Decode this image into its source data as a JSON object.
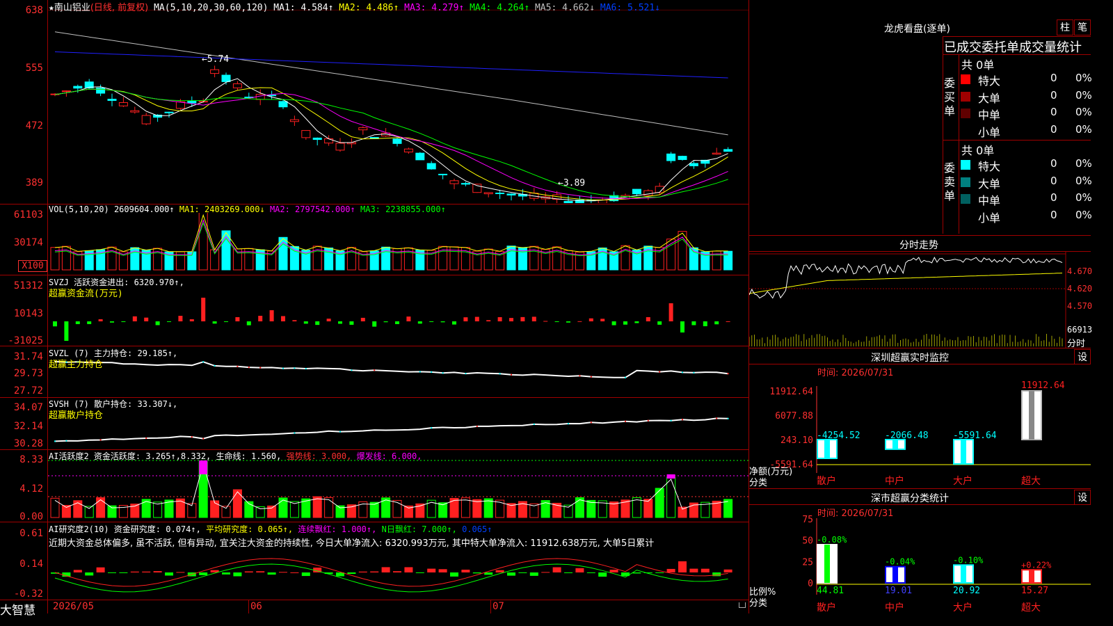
{
  "colors": {
    "up": "#ff2020",
    "down": "#00ffff",
    "grid": "#a00000",
    "axis": "#ff3030",
    "green": "#00ff00",
    "yellow": "#ffff00",
    "magenta": "#ff00ff",
    "blue": "#0000ff",
    "white": "#ffffff"
  },
  "main": {
    "star": "★",
    "stock_name": "南山铝业",
    "mode": "(日线, 前复权)",
    "ma_params": "MA(5,10,20,30,60,120)",
    "ma1": "MA1: 4.584↑",
    "ma2": "MA2: 4.486↑",
    "ma3": "MA3: 4.279↑",
    "ma4": "MA4: 4.264↑",
    "ma5": "MA5: 4.662↓",
    "ma6": "MA6: 5.521↓",
    "axis": [
      "638",
      "555",
      "472",
      "389"
    ],
    "high_marker": "←5.74",
    "low_marker": "←3.89"
  },
  "vol": {
    "title": "VOL(5,10,20)",
    "value": "2609604.000↑",
    "ma1": "MA1: 2403269.000↓",
    "ma2": "MA2: 2797542.000↑",
    "ma3": "MA3: 2238855.000↑",
    "axis": [
      "61103",
      "30174"
    ],
    "unit": "X100"
  },
  "svzj": {
    "title": "SVZJ 活跃资金进出: 6320.970↑,",
    "sub": "超赢资金流(万元)",
    "axis": [
      "51312",
      "10143",
      "-31025"
    ]
  },
  "svzl": {
    "title": "SVZL (7) 主力持仓: 29.185↑,",
    "sub": "超赢主力持仓",
    "axis": [
      "31.74",
      "29.73",
      "27.72"
    ]
  },
  "svsh": {
    "title": "SVSH (7) 散户持仓: 33.307↓,",
    "sub": "超赢散户持仓",
    "axis": [
      "34.07",
      "32.14",
      "30.28"
    ]
  },
  "ai1": {
    "title": "AI活跃度2 资金活跃度: 3.265↑,",
    "v2": "8.332,",
    "life": "生命线: 1.560,",
    "strong": "强势线: 3.000,",
    "burst": "爆发线: 6.000,",
    "axis": [
      "8.33",
      "4.12",
      "0.00"
    ]
  },
  "ai2": {
    "title": "AI研究度2(10) 资金研究度: 0.074↑,",
    "avg": "平均研究度: 0.065↑,",
    "lianxu": "连续飘红: 1.000↑,",
    "nday": "N日飘红: 7.000↑,",
    "last": "0.065↑",
    "axis": [
      "0.61",
      "0.14",
      "-0.32"
    ],
    "comment": "近期大资金总体偏多, 虽不活跃, 但有异动, 宜关注大资金的持续性, 今日大单净流入: 6320.993万元, 其中特大单净流入: 11912.638万元, 大单5日累计"
  },
  "dates": {
    "d1": "2026/05",
    "d2": "06",
    "d3": "07"
  },
  "brand": "大智慧",
  "right": {
    "lhkp_title": "龙虎看盘(逐单)",
    "btn_zhu": "柱",
    "btn_bi": "笔",
    "stats_title": "已成交委托单成交量统计",
    "buy": {
      "label_chars": [
        "委",
        "买",
        "单"
      ],
      "total": "共 0单",
      "rows": [
        {
          "name": "特大",
          "val": "0",
          "pct": "0%",
          "color": "#ff0000"
        },
        {
          "name": "大单",
          "val": "0",
          "pct": "0%",
          "color": "#a00000"
        },
        {
          "name": "中单",
          "val": "0",
          "pct": "0%",
          "color": "#600000"
        },
        {
          "name": "小单",
          "val": "0",
          "pct": "0%",
          "color": "#000000"
        }
      ]
    },
    "sell": {
      "label_chars": [
        "委",
        "卖",
        "单"
      ],
      "total": "共 0单",
      "rows": [
        {
          "name": "特大",
          "val": "0",
          "pct": "0%",
          "color": "#00ffff"
        },
        {
          "name": "大单",
          "val": "0",
          "pct": "0%",
          "color": "#008080"
        },
        {
          "name": "中单",
          "val": "0",
          "pct": "0%",
          "color": "#006060"
        },
        {
          "name": "小单",
          "val": "0",
          "pct": "0%",
          "color": "#000000"
        }
      ]
    },
    "fenshi_title": "分时走势",
    "fenshi_axis": [
      "4.670",
      "4.620",
      "4.570"
    ],
    "fenshi_vol": "66913",
    "fenshi_label": "分时",
    "sz_title": "深圳超赢实时监控",
    "btn_she1": "设",
    "time1": "时间: 2026/07/31",
    "sz_axis": [
      "11912.64",
      "6077.88",
      "243.10",
      "-5591.64"
    ],
    "sz_unit": "净额(万元)",
    "sz_cat_label": "分类",
    "sz_bars": [
      {
        "cat": "散户",
        "val": "-4254.52",
        "value": -4254.52
      },
      {
        "cat": "中户",
        "val": "-2066.48",
        "value": -2066.48
      },
      {
        "cat": "大户",
        "val": "-5591.64",
        "value": -5591.64
      },
      {
        "cat": "超大",
        "val": "11912.64",
        "value": 11912.64
      }
    ],
    "ss_title": "深市超赢分类统计",
    "btn_she2": "设",
    "time2": "时间: 2026/07/31",
    "ss_axis": [
      "75",
      "50",
      "25",
      "0"
    ],
    "ss_unit": "比例%",
    "ss_cat_label": "分类",
    "ss_bars": [
      {
        "cat": "散户",
        "change": "-0.08%",
        "val": "44.81",
        "value": 44.81,
        "color": "#ffffff"
      },
      {
        "cat": "中户",
        "change": "-0.04%",
        "val": "19.01",
        "value": 19.01,
        "color": "#0000ff"
      },
      {
        "cat": "大户",
        "change": "-0.10%",
        "val": "20.92",
        "value": 20.92,
        "color": "#00ffff"
      },
      {
        "cat": "超大",
        "change": "+0.22%",
        "val": "15.27",
        "value": 15.27,
        "color": "#ff2020"
      }
    ]
  }
}
